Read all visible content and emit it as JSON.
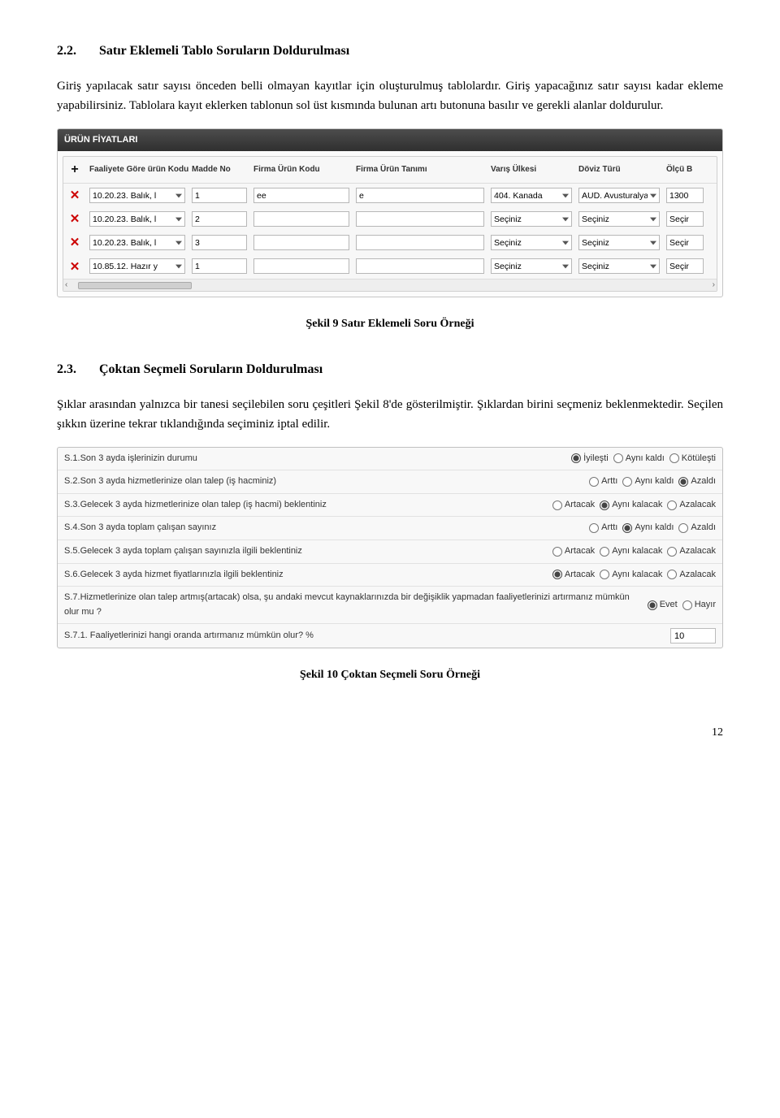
{
  "section22": {
    "num": "2.2.",
    "title": "Satır Eklemeli Tablo Soruların Doldurulması",
    "para": "Giriş yapılacak satır sayısı önceden belli olmayan kayıtlar için oluşturulmuş tablolardır. Giriş yapacağınız satır sayısı kadar ekleme yapabilirsiniz. Tablolara kayıt eklerken tablonun sol üst kısmında bulunan artı butonuna basılır ve gerekli alanlar doldurulur."
  },
  "fig9": {
    "caption": "Şekil 9 Satır Eklemeli Soru Örneği",
    "title": "ÜRÜN FİYATLARI",
    "cols": [
      "Faaliyete Göre ürün Kodu (CPA)",
      "Madde No",
      "Firma Ürün Kodu",
      "Firma Ürün Tanımı",
      "Varış Ülkesi",
      "Döviz Türü",
      "Ölçü B"
    ],
    "placeholder": "Seçiniz",
    "scroll": {
      "left": "‹",
      "right": "›"
    },
    "rows": [
      {
        "cpa": "10.20.23. Balık, l",
        "madde": "1",
        "kodu": "ee",
        "tanim": "e",
        "ulke": "404. Kanada",
        "doviz": "AUD. Avusturalya",
        "olcu": "1300"
      },
      {
        "cpa": "10.20.23. Balık, l",
        "madde": "2",
        "kodu": "",
        "tanim": "",
        "ulke": "Seçiniz",
        "doviz": "Seçiniz",
        "olcu": "Seçir"
      },
      {
        "cpa": "10.20.23. Balık, l",
        "madde": "3",
        "kodu": "",
        "tanim": "",
        "ulke": "Seçiniz",
        "doviz": "Seçiniz",
        "olcu": "Seçir"
      },
      {
        "cpa": "10.85.12. Hazır y",
        "madde": "1",
        "kodu": "",
        "tanim": "",
        "ulke": "Seçiniz",
        "doviz": "Seçiniz",
        "olcu": "Seçir"
      }
    ]
  },
  "section23": {
    "num": "2.3.",
    "title": "Çoktan Seçmeli Soruların Doldurulması",
    "para": "Şıklar arasından yalnızca bir tanesi seçilebilen soru çeşitleri Şekil 8'de gösterilmiştir. Şıklardan birini seçmeniz beklenmektedir. Seçilen şıkkın üzerine tekrar tıklandığında seçiminiz iptal edilir."
  },
  "fig10": {
    "caption": "Şekil 10 Çoktan Seçmeli Soru Örneği",
    "rows": [
      {
        "q": "S.1.Son 3 ayda işlerinizin durumu",
        "opts": [
          "İyileşti",
          "Aynı kaldı",
          "Kötüleşti"
        ],
        "sel": 0
      },
      {
        "q": "S.2.Son 3 ayda hizmetlerinize olan talep (iş hacminiz)",
        "opts": [
          "Arttı",
          "Aynı kaldı",
          "Azaldı"
        ],
        "sel": 2
      },
      {
        "q": "S.3.Gelecek 3 ayda hizmetlerinize olan talep (iş hacmi) beklentiniz",
        "opts": [
          "Artacak",
          "Aynı kalacak",
          "Azalacak"
        ],
        "sel": 1
      },
      {
        "q": "S.4.Son 3 ayda toplam çalışan sayınız",
        "opts": [
          "Arttı",
          "Aynı kaldı",
          "Azaldı"
        ],
        "sel": 1
      },
      {
        "q": "S.5.Gelecek 3 ayda toplam çalışan sayınızla ilgili beklentiniz",
        "opts": [
          "Artacak",
          "Aynı kalacak",
          "Azalacak"
        ],
        "sel": -1
      },
      {
        "q": "S.6.Gelecek 3 ayda hizmet fiyatlarınızla ilgili beklentiniz",
        "opts": [
          "Artacak",
          "Aynı kalacak",
          "Azalacak"
        ],
        "sel": 0
      },
      {
        "q": "S.7.Hizmetlerinize olan talep artmış(artacak) olsa, şu andaki mevcut kaynaklarınızda bir değişiklik yapmadan faaliyetlerinizi artırmanız mümkün olur mu ?",
        "opts": [
          "Evet",
          "Hayır"
        ],
        "sel": 0
      },
      {
        "q": "S.7.1. Faaliyetlerinizi hangi oranda artırmanız mümkün olur? %",
        "input": "10"
      }
    ]
  },
  "page": "12"
}
